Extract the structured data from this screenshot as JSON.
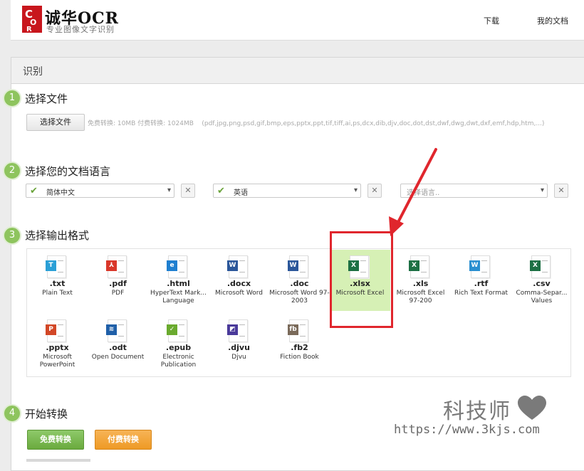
{
  "header": {
    "logo_title": "诚华OCR",
    "logo_subtitle": "专业图像文字识别",
    "nav": [
      "下载",
      "我的文档"
    ]
  },
  "panel": {
    "title": "识别"
  },
  "steps": [
    {
      "num": "1",
      "title": "选择文件"
    },
    {
      "num": "2",
      "title": "选择您的文档语言"
    },
    {
      "num": "3",
      "title": "选择输出格式"
    },
    {
      "num": "4",
      "title": "开始转换"
    }
  ],
  "upload": {
    "button_label": "选择文件",
    "limits": "免费转换: 10MB  付费转换: 1024MB",
    "formats": "(pdf,jpg,png,psd,gif,bmp,eps,pptx,ppt,tif,tiff,ai,ps,dcx,dib,djv,doc,dot,dst,dwf,dwg,dwt,dxf,emf,hdp,htm,...)"
  },
  "languages": [
    {
      "value": "简体中文",
      "placeholder": ""
    },
    {
      "value": "英语",
      "placeholder": ""
    },
    {
      "value": "",
      "placeholder": "选择语言.."
    }
  ],
  "clear_label": "✕",
  "formats": [
    {
      "ext": ".txt",
      "name": "Plain Text",
      "icon": "text-file-icon",
      "badge": "T",
      "color": "#2a9fd6",
      "selected": false
    },
    {
      "ext": ".pdf",
      "name": "PDF",
      "icon": "pdf-file-icon",
      "badge": "⅄",
      "color": "#d9372a",
      "selected": false
    },
    {
      "ext": ".html",
      "name": "HyperText Mark... Language",
      "icon": "html-file-icon",
      "badge": "e",
      "color": "#1e7fd0",
      "selected": false
    },
    {
      "ext": ".docx",
      "name": "Microsoft Word",
      "icon": "word-file-icon",
      "badge": "W",
      "color": "#2b579a",
      "selected": false
    },
    {
      "ext": ".doc",
      "name": "Microsoft Word 97-2003",
      "icon": "word-file-icon",
      "badge": "W",
      "color": "#2b579a",
      "selected": false
    },
    {
      "ext": ".xlsx",
      "name": "Microsoft Excel",
      "icon": "excel-file-icon",
      "badge": "X",
      "color": "#1d7044",
      "selected": true
    },
    {
      "ext": ".xls",
      "name": "Microsoft Excel 97-200",
      "icon": "excel-file-icon",
      "badge": "X",
      "color": "#1d7044",
      "selected": false
    },
    {
      "ext": ".rtf",
      "name": "Rich Text Format",
      "icon": "rtf-file-icon",
      "badge": "W",
      "color": "#2a8fd0",
      "selected": false
    },
    {
      "ext": ".csv",
      "name": "Comma-Separ... Values",
      "icon": "csv-file-icon",
      "badge": "X",
      "color": "#1d7044",
      "selected": false
    },
    {
      "ext": ".pptx",
      "name": "Microsoft PowerPoint",
      "icon": "powerpoint-file-icon",
      "badge": "P",
      "color": "#d24726",
      "selected": false
    },
    {
      "ext": ".odt",
      "name": "Open Document",
      "icon": "odt-file-icon",
      "badge": "≋",
      "color": "#1f5fa8",
      "selected": false
    },
    {
      "ext": ".epub",
      "name": "Electronic Publication",
      "icon": "epub-file-icon",
      "badge": "✓",
      "color": "#6aaa2e",
      "selected": false
    },
    {
      "ext": ".djvu",
      "name": "Djvu",
      "icon": "djvu-file-icon",
      "badge": "◩",
      "color": "#4a3a9a",
      "selected": false
    },
    {
      "ext": ".fb2",
      "name": "Fiction Book",
      "icon": "fb2-file-icon",
      "badge": "fb",
      "color": "#7a6a5a",
      "selected": false
    }
  ],
  "actions": {
    "free": "免费转换",
    "paid": "付费转换"
  },
  "watermark": {
    "name": "科技师",
    "url": "https://www.3kjs.com"
  }
}
